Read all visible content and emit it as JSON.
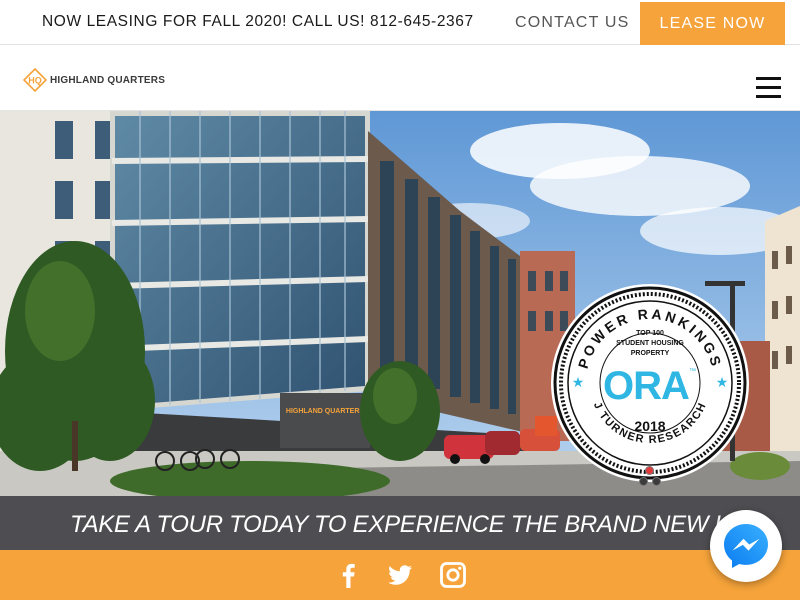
{
  "topbar": {
    "announcement": "NOW LEASING FOR FALL 2020! CALL US! 812-645-2367",
    "contact_label": "CONTACT US",
    "lease_label": "LEASE NOW"
  },
  "nav": {
    "logo_monogram": "HQ",
    "logo_text": "HIGHLAND QUARTERS"
  },
  "hero": {
    "building_sign": "HIGHLAND QUARTERS",
    "badge": {
      "arc_top": "POWER RANKINGS",
      "line1": "TOP 100",
      "line2": "STUDENT HOUSING",
      "line3": "PROPERTY",
      "brand": "ORA",
      "trademark": "™",
      "year": "2018",
      "arc_bottom": "J TURNER RESEARCH"
    },
    "slides": 3,
    "active_slide": 1
  },
  "tour": {
    "text": "TAKE A TOUR TODAY TO EXPERIENCE THE BRAND NEW HQ!"
  },
  "social": {
    "icons": [
      "facebook-icon",
      "twitter-icon",
      "instagram-icon"
    ]
  },
  "colors": {
    "accent": "#f5a33a",
    "tour_bg": "#4e4e52",
    "messenger": "#1d8cf8"
  }
}
